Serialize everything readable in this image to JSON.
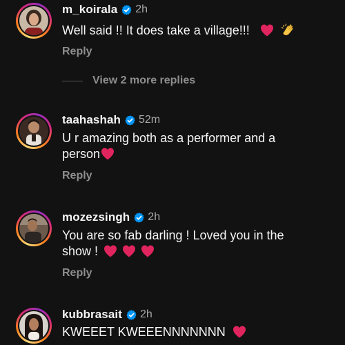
{
  "comments": [
    {
      "username": "m_koirala",
      "verified": true,
      "time": "2h",
      "text_lines": [
        "Well said !! It does take a village!!!"
      ],
      "emojis": [
        "red-heart",
        "clapping-hands"
      ],
      "reply_label": "Reply",
      "view_replies_label": "View 2 more replies"
    },
    {
      "username": "taahashah",
      "verified": true,
      "time": "52m",
      "text_lines": [
        "U r amazing both as a performer and a",
        "person"
      ],
      "emojis": [
        "red-heart"
      ],
      "reply_label": "Reply"
    },
    {
      "username": "mozezsingh",
      "verified": true,
      "time": "2h",
      "text_lines": [
        "You are so fab darling ! Loved you in the",
        "show !"
      ],
      "emojis": [
        "red-heart",
        "red-heart",
        "red-heart"
      ],
      "reply_label": "Reply"
    },
    {
      "username": "kubbrasait",
      "verified": true,
      "time": "2h",
      "text_lines": [
        "KWEEET KWEEENNNNNNN"
      ],
      "emojis": [
        "red-heart"
      ]
    }
  ],
  "colors": {
    "background": "#121212",
    "text": "#f5f5f5",
    "secondary_text": "#8e8e8e",
    "verified_badge": "#0095f6",
    "heart": "#e0245e"
  },
  "icons": {
    "verified": "verified-badge-icon",
    "heart": "red-heart-emoji",
    "clap": "clapping-hands-emoji"
  }
}
